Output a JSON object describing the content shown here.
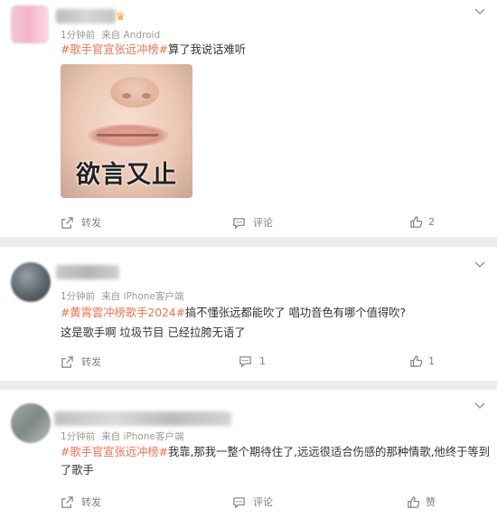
{
  "comments": [
    {
      "meta": {
        "time": "1分钟前",
        "source": "来自 Android"
      },
      "hashtag": "#歌手官宣张远冲榜#",
      "text": "算了我说话难听",
      "image_caption": "欲言又止",
      "actions": {
        "repost": "转发",
        "comment": "评论",
        "likes": "2"
      }
    },
    {
      "meta": {
        "time": "1分钟前",
        "source": "来自 iPhone客户端"
      },
      "hashtag": "#黄霄雲冲榜歌手2024#",
      "text": "搞不懂张远都能吹了 唱功音色有哪个值得吹?",
      "text2": "这是歌手啊 垃圾节目 已经拉胯无语了",
      "actions": {
        "repost": "转发",
        "comments": "1",
        "likes": "1"
      }
    },
    {
      "meta": {
        "time": "1分钟前",
        "source": "来自 iPhone客户端"
      },
      "hashtag": "#歌手官宣张远冲榜#",
      "text": "我靠,那我一整个期待住了,远远很适合伤感的那种情歌,他终于等到了歌手",
      "actions": {
        "repost": "转发",
        "comment": "评论",
        "like": "赞"
      }
    }
  ],
  "colors": {
    "hashtag": "#eb7350",
    "meta": "#999999",
    "action": "#808080",
    "crown": "#f6a623"
  },
  "icons": [
    "chevron-down-icon",
    "share-icon",
    "comment-icon",
    "thumbs-up-icon",
    "crown-icon"
  ]
}
